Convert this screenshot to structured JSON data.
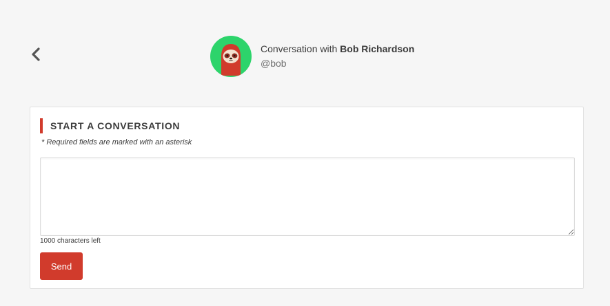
{
  "header": {
    "title_prefix": "Conversation with",
    "user_name": "Bob Richardson",
    "handle": "@bob",
    "avatar_icon": "sloth-avatar-icon",
    "avatar_bg": "#2dd46b"
  },
  "nav": {
    "back_icon": "chevron-left-icon"
  },
  "form": {
    "title": "START A CONVERSATION",
    "required_note": "* Required fields are marked with an asterisk",
    "message_value": "",
    "message_placeholder": "",
    "chars_left": "1000 characters left",
    "send_label": "Send"
  },
  "colors": {
    "accent": "#d13b2c",
    "page_background": "#f6f6f6"
  }
}
